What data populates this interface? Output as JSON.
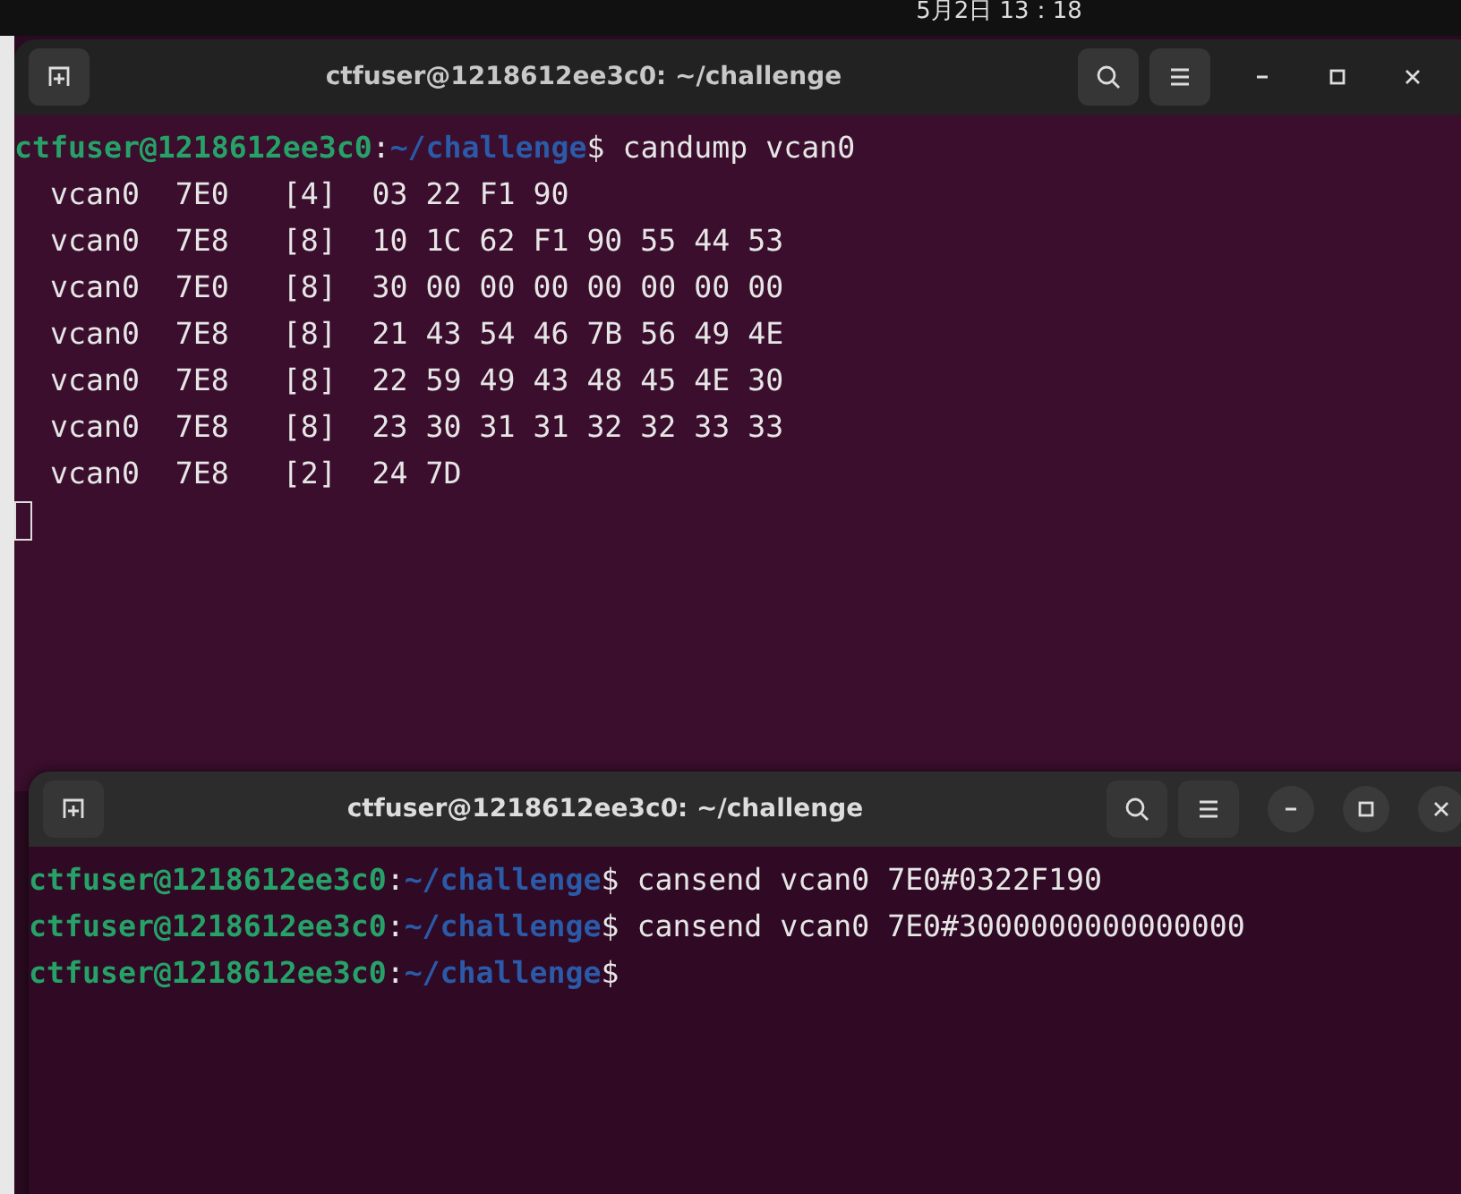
{
  "top_bar": {
    "clock": "5月2日 13：18"
  },
  "windows": [
    {
      "title": "ctfuser@1218612ee3c0: ~/challenge",
      "active": false,
      "lines": [
        {
          "kind": "prompt",
          "user_host": "ctfuser@1218612ee3c0",
          "separator": ":",
          "path": "~/challenge",
          "symbol": "$",
          "command": " candump vcan0"
        },
        {
          "kind": "output",
          "text": "  vcan0  7E0   [4]  03 22 F1 90"
        },
        {
          "kind": "output",
          "text": "  vcan0  7E8   [8]  10 1C 62 F1 90 55 44 53"
        },
        {
          "kind": "output",
          "text": "  vcan0  7E0   [8]  30 00 00 00 00 00 00 00"
        },
        {
          "kind": "output",
          "text": "  vcan0  7E8   [8]  21 43 54 46 7B 56 49 4E"
        },
        {
          "kind": "output",
          "text": "  vcan0  7E8   [8]  22 59 49 43 48 45 4E 30"
        },
        {
          "kind": "output",
          "text": "  vcan0  7E8   [8]  23 30 31 31 32 32 33 33"
        },
        {
          "kind": "output",
          "text": "  vcan0  7E8   [2]  24 7D"
        },
        {
          "kind": "cursor"
        }
      ]
    },
    {
      "title": "ctfuser@1218612ee3c0: ~/challenge",
      "active": true,
      "lines": [
        {
          "kind": "prompt",
          "user_host": "ctfuser@1218612ee3c0",
          "separator": ":",
          "path": "~/challenge",
          "symbol": "$",
          "command": " cansend vcan0 7E0#0322F190"
        },
        {
          "kind": "prompt",
          "user_host": "ctfuser@1218612ee3c0",
          "separator": ":",
          "path": "~/challenge",
          "symbol": "$",
          "command": " cansend vcan0 7E0#3000000000000000"
        },
        {
          "kind": "prompt",
          "user_host": "ctfuser@1218612ee3c0",
          "separator": ":",
          "path": "~/challenge",
          "symbol": "$"
        }
      ]
    }
  ]
}
